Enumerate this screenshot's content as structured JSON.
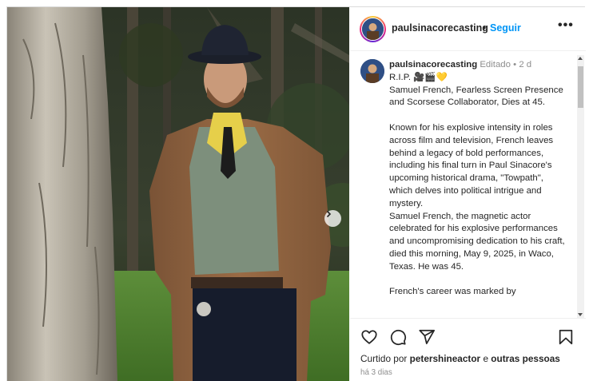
{
  "post": {
    "username": "paulsinacorecasting",
    "follow_label": "Seguir",
    "separator_dot": "•",
    "more_label": "•••",
    "caption": {
      "username": "paulsinacorecasting",
      "edited": "Editado",
      "meta_dot": "•",
      "age": "2 d",
      "rip_line": "R.I.P. 🎥🎬💛",
      "paragraphs": [
        "Samuel French, Fearless Screen Presence and Scorsese Collaborator, Dies at 45.",
        "",
        "Known for his explosive intensity in roles across film and television, French leaves behind a legacy of bold performances, including his final turn in Paul Sinacore's upcoming historical drama, \"Towpath\", which delves into political intrigue and mystery.",
        "Samuel French, the magnetic actor celebrated for his explosive performances and uncompromising dedication to his craft, died this morning, May 9, 2025, in Waco, Texas. He was 45.",
        "",
        "French's career was marked by"
      ]
    },
    "likes": {
      "prefix": "Curtido por",
      "user": "petershineactor",
      "joiner": "e",
      "others": "outras pessoas"
    },
    "posted_ago": "há 3 dias"
  },
  "icons": {
    "next": "chevron-right-icon",
    "like": "heart-icon",
    "comment": "comment-icon",
    "share": "paper-plane-icon",
    "save": "bookmark-icon",
    "more": "more-icon"
  },
  "colors": {
    "accent": "#0095f6",
    "text": "#262626",
    "muted": "#8e8e8e",
    "border": "#dbdbdb"
  }
}
